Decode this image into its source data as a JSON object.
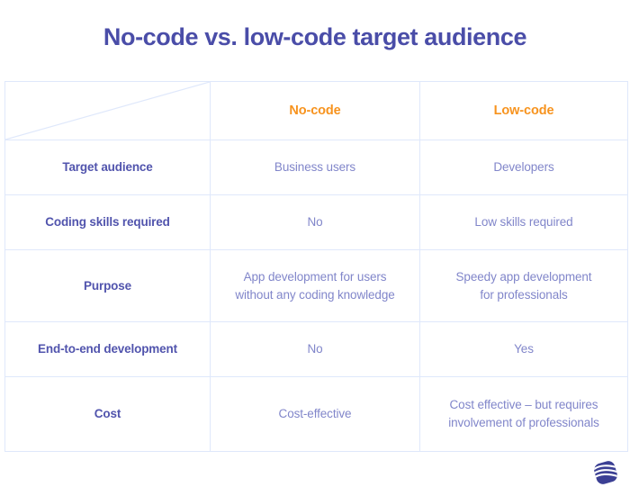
{
  "page": {
    "title": "No-code vs. low-code target audience"
  },
  "colors": {
    "title": "#4a4da8",
    "header_accent": "#f7931e",
    "row_label": "#5154ad",
    "cell_text": "#8186ca",
    "border": "#dfe8fb",
    "logo": "#3b3f94",
    "background": "#ffffff"
  },
  "table": {
    "corner_cell": "",
    "columns": [
      {
        "key": "label",
        "label": ""
      },
      {
        "key": "nocode",
        "label": "No-code"
      },
      {
        "key": "lowcode",
        "label": "Low-code"
      }
    ],
    "rows": [
      {
        "label": "Target audience",
        "nocode": {
          "lines": [
            "Business users"
          ]
        },
        "lowcode": {
          "lines": [
            "Developers"
          ]
        }
      },
      {
        "label": "Coding skills required",
        "nocode": {
          "lines": [
            "No"
          ]
        },
        "lowcode": {
          "lines": [
            "Low skills required"
          ]
        }
      },
      {
        "label": "Purpose",
        "nocode": {
          "lines": [
            "App development for users",
            "without any coding knowledge"
          ]
        },
        "lowcode": {
          "lines": [
            "Speedy app development",
            "for professionals"
          ]
        }
      },
      {
        "label": "End-to-end development",
        "nocode": {
          "lines": [
            "No"
          ]
        },
        "lowcode": {
          "lines": [
            "Yes"
          ]
        }
      },
      {
        "label": "Cost",
        "nocode": {
          "lines": [
            "Cost-effective"
          ]
        },
        "lowcode": {
          "lines": [
            "Cost effective – but requires",
            "involvement of professionals"
          ]
        }
      }
    ]
  },
  "footer": {
    "logo_name": "company-logo-icon"
  }
}
